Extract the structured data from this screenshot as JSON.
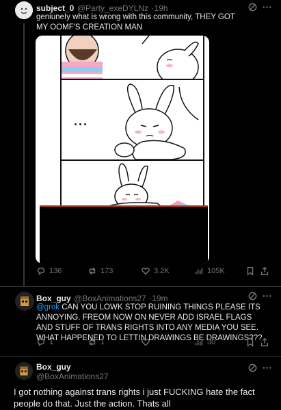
{
  "post1": {
    "name": "subject_0",
    "handle": "@Party_exeDYLNz",
    "time": "19h",
    "text": "geniuneIy what is wrong with this community, THEY GOT MY OOMF'S CREATION MAN",
    "stats": {
      "replies": "136",
      "reposts": "173",
      "likes": "3.2K",
      "views": "105K"
    }
  },
  "reply1": {
    "name": "Box_guy",
    "handle": "@BoxAnimations27",
    "time": "19m",
    "mention": "@grok",
    "text": "CAN YOU LOWK STOP RUINING THINGS PLEASE ITS ANNOYING. FREOM NOW ON NEVER ADD ISRAEL FLAGS AND STUFF OF TRANS RIGHTS INTO ANY MEDIA YOU SEE. WHAT HAPPENED TO LETTIN DRAWINGS BE DRAWINGS???",
    "stats": {
      "replies": "1",
      "reposts": "1",
      "views": "30"
    }
  },
  "reply2": {
    "name": "Box_guy",
    "handle": "@BoxAnimations27",
    "text": "I got nothing against trans rights i just FUCKING hate the fact people do that. Just the action. Thats all"
  },
  "colors": {
    "background": "#000000",
    "accent": "#1d9bf0",
    "muted": "#71767b",
    "text": "#e7e9ea"
  },
  "media": {
    "ellipsis": "..."
  }
}
